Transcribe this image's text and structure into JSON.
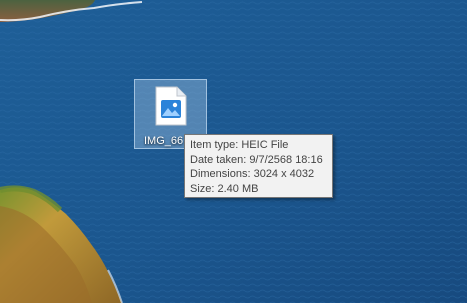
{
  "desktop": {
    "wallpaper": "coastal-cliffs-and-ocean",
    "file": {
      "icon": "image-file-icon",
      "label": "IMG_66"
    }
  },
  "tooltip": {
    "item_type": "Item type: HEIC File",
    "date_taken": "Date taken: 9/7/2568 18:16",
    "dimensions": "Dimensions: 3024 x 4032",
    "size": "Size: 2.40 MB"
  },
  "colors": {
    "ocean": "#1f5c93",
    "cliff_green": "#b39534",
    "selection": "#aecdeb",
    "tooltip_bg": "#f2f2f2",
    "icon_blue": "#2b83d9"
  }
}
